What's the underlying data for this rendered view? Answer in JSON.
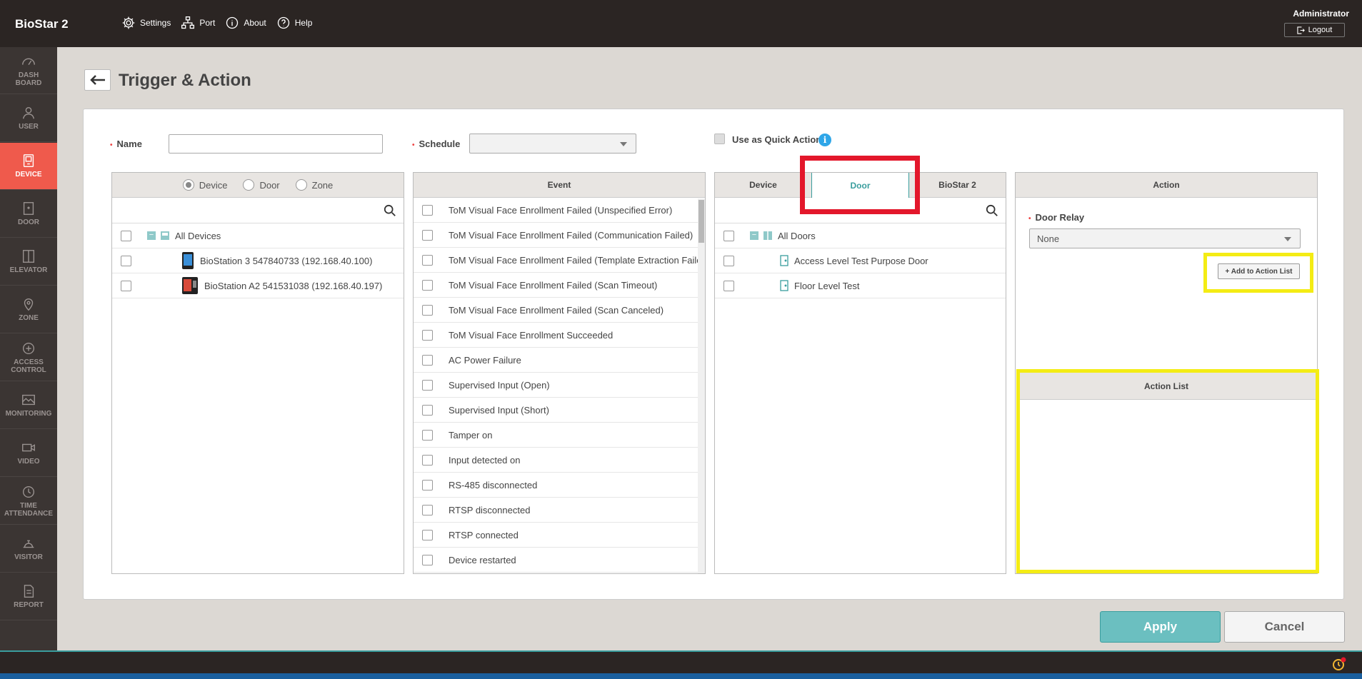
{
  "app": {
    "logo": "BioStar 2",
    "user": "Administrator",
    "logout_label": "Logout"
  },
  "topmenu": [
    {
      "label": "Settings",
      "icon": "gear-icon"
    },
    {
      "label": "Port",
      "icon": "network-icon"
    },
    {
      "label": "About",
      "icon": "info-icon"
    },
    {
      "label": "Help",
      "icon": "help-icon"
    }
  ],
  "sidebar": [
    {
      "line1": "DASH",
      "line2": "BOARD",
      "icon": "gauge-icon"
    },
    {
      "line1": "USER",
      "line2": "",
      "icon": "user-icon"
    },
    {
      "line1": "DEVICE",
      "line2": "",
      "icon": "device-icon",
      "active": true
    },
    {
      "line1": "DOOR",
      "line2": "",
      "icon": "door-icon"
    },
    {
      "line1": "ELEVATOR",
      "line2": "",
      "icon": "elevator-icon"
    },
    {
      "line1": "ZONE",
      "line2": "",
      "icon": "map-pin-icon"
    },
    {
      "line1": "ACCESS",
      "line2": "CONTROL",
      "icon": "access-control-icon"
    },
    {
      "line1": "MONITORING",
      "line2": "",
      "icon": "monitoring-icon"
    },
    {
      "line1": "VIDEO",
      "line2": "",
      "icon": "video-icon"
    },
    {
      "line1": "TIME",
      "line2": "ATTENDANCE",
      "icon": "clock-icon"
    },
    {
      "line1": "VISITOR",
      "line2": "",
      "icon": "visitor-icon"
    },
    {
      "line1": "REPORT",
      "line2": "",
      "icon": "report-icon"
    }
  ],
  "page": {
    "title": "Trigger & Action"
  },
  "form": {
    "name_label": "Name",
    "name_value": "",
    "schedule_label": "Schedule",
    "schedule_value": "",
    "quick_action_label": "Use as Quick Action"
  },
  "trigger_panel": {
    "radios": [
      "Device",
      "Door",
      "Zone"
    ],
    "selected": "Device",
    "all_label": "All Devices",
    "devices": [
      "BioStation 3 547840733 (192.168.40.100)",
      "BioStation A2 541531038 (192.168.40.197)"
    ]
  },
  "event_panel": {
    "header": "Event",
    "events": [
      "ToM Visual Face Enrollment Failed (Unspecified Error)",
      "ToM Visual Face Enrollment Failed (Communication Failed)",
      "ToM Visual Face Enrollment Failed (Template Extraction Faile",
      "ToM Visual Face Enrollment Failed (Scan Timeout)",
      "ToM Visual Face Enrollment Failed (Scan Canceled)",
      "ToM Visual Face Enrollment Succeeded",
      "AC Power Failure",
      "Supervised Input (Open)",
      "Supervised Input (Short)",
      "Tamper on",
      "Input detected on",
      "RS-485 disconnected",
      "RTSP disconnected",
      "RTSP connected",
      "Device restarted"
    ]
  },
  "target_panel": {
    "tabs": [
      "Device",
      "Door",
      "BioStar 2"
    ],
    "active_tab": "Door",
    "all_label": "All Doors",
    "doors": [
      "Access Level Test Purpose Door",
      "Floor Level Test"
    ]
  },
  "action_panel": {
    "header": "Action",
    "relay_label": "Door Relay",
    "relay_value": "None",
    "add_button": "+ Add to Action List",
    "list_header": "Action List"
  },
  "buttons": {
    "apply": "Apply",
    "cancel": "Cancel"
  },
  "colors": {
    "accent": "#3a9e9e",
    "active_nav": "#ef5a4c",
    "highlight_red": "#e3172b",
    "highlight_yellow": "#f4ec14"
  }
}
